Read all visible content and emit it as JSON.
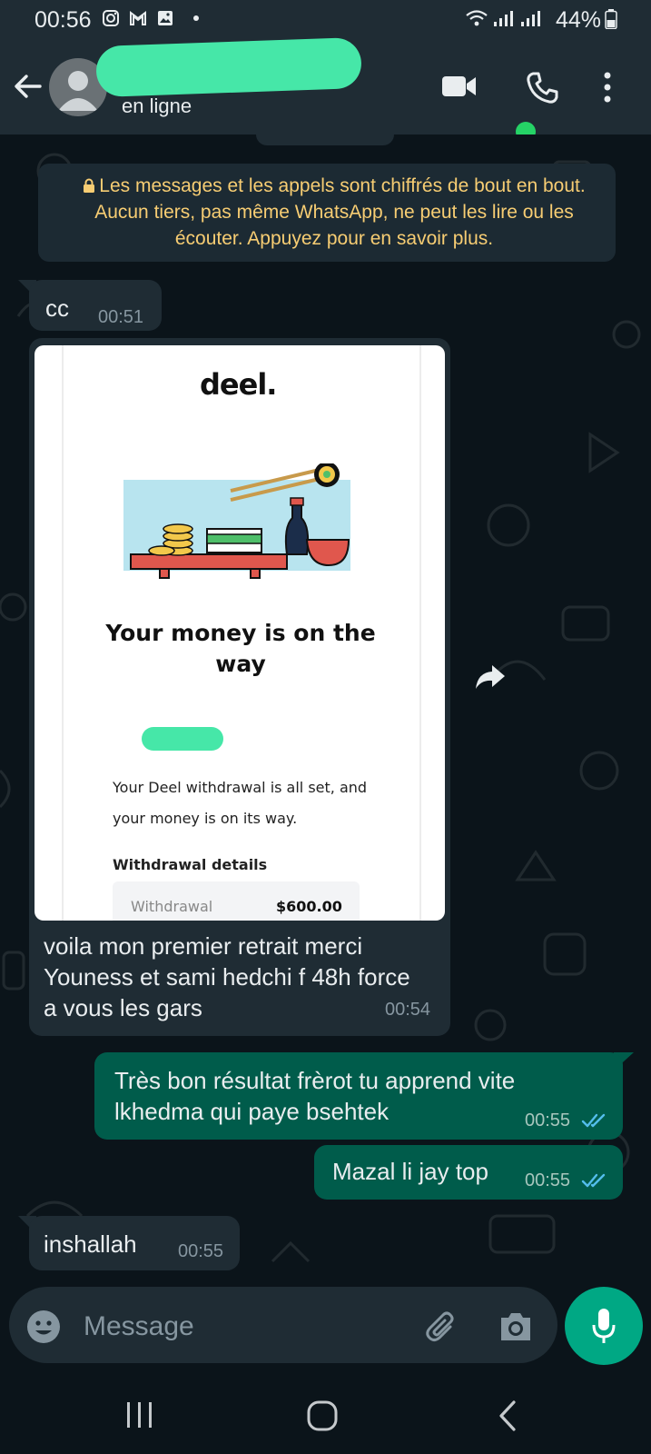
{
  "status_bar": {
    "time": "00:56",
    "battery": "44%"
  },
  "header": {
    "contact_name": "",
    "presence": "en ligne"
  },
  "encryption_notice": {
    "text": "Les messages et les appels sont chiffrés de bout en bout. Aucun tiers, pas même WhatsApp, ne peut les lire ou les écouter. Appuyez pour en savoir plus."
  },
  "messages": [
    {
      "direction": "incoming",
      "text": "cc",
      "time": "00:51"
    },
    {
      "direction": "incoming",
      "type": "image",
      "image": {
        "logo": "deel.",
        "headline": "Your money is on the way",
        "body": "Your Deel withdrawal is all set, and your money is on its way.",
        "details_title": "Withdrawal details",
        "withdrawal_label": "Withdrawal",
        "withdrawal_amount": "$600.00"
      },
      "text": "voila mon premier retrait merci Youness et sami hedchi f 48h force a vous les gars",
      "time": "00:54"
    },
    {
      "direction": "outgoing",
      "text": "Très bon résultat frèrot tu apprend vite lkhedma qui paye bsehtek",
      "time": "00:55",
      "status": "read"
    },
    {
      "direction": "outgoing",
      "text": "Mazal li jay top",
      "time": "00:55",
      "status": "read"
    },
    {
      "direction": "incoming",
      "text": "inshallah",
      "time": "00:55"
    }
  ],
  "composer": {
    "placeholder": "Message",
    "value": ""
  },
  "colors": {
    "header_bg": "#1f2c34",
    "chat_bg": "#0b141a",
    "incoming_bubble": "#1f2c34",
    "outgoing_bubble": "#005c4b",
    "accent": "#00a884",
    "notice_text": "#f7cd73",
    "read_ticks": "#53bdeb",
    "redaction": "#46e7a8"
  },
  "icons": {
    "status": [
      "instagram-icon",
      "gmail-icon",
      "gallery-icon",
      "dot-icon",
      "wifi-icon",
      "signal-icon",
      "signal-icon",
      "battery-icon"
    ],
    "header": [
      "back-icon",
      "avatar",
      "video-call-icon",
      "voice-call-icon",
      "menu-icon"
    ],
    "composer": [
      "emoji-icon",
      "attach-icon",
      "camera-icon",
      "mic-icon"
    ],
    "navigation": [
      "recents-icon",
      "home-icon",
      "back-nav-icon"
    ]
  }
}
